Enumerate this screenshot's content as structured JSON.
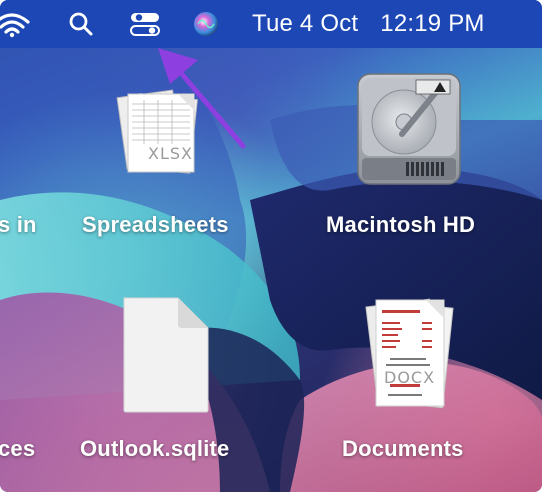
{
  "menubar": {
    "icons": [
      "wifi-icon",
      "search-icon",
      "control-center-icon",
      "siri-icon"
    ],
    "date": "Tue 4 Oct",
    "time": "12:19 PM",
    "background_color": "#1c47b5"
  },
  "desktop": {
    "items": [
      {
        "label": "s in",
        "icon": "partial-icon"
      },
      {
        "label": "Spreadsheets",
        "icon": "xlsx-document-stack-icon",
        "file_badge": "XLSX"
      },
      {
        "label": "Macintosh HD",
        "icon": "hard-drive-icon"
      },
      {
        "label": "ces",
        "icon": "partial-icon"
      },
      {
        "label": "Outlook.sqlite",
        "icon": "blank-document-icon"
      },
      {
        "label": "Documents",
        "icon": "docx-document-stack-icon",
        "file_badge": "DOCX"
      }
    ]
  },
  "annotation": {
    "icon": "arrow-icon",
    "color": "#8e3fe0"
  }
}
